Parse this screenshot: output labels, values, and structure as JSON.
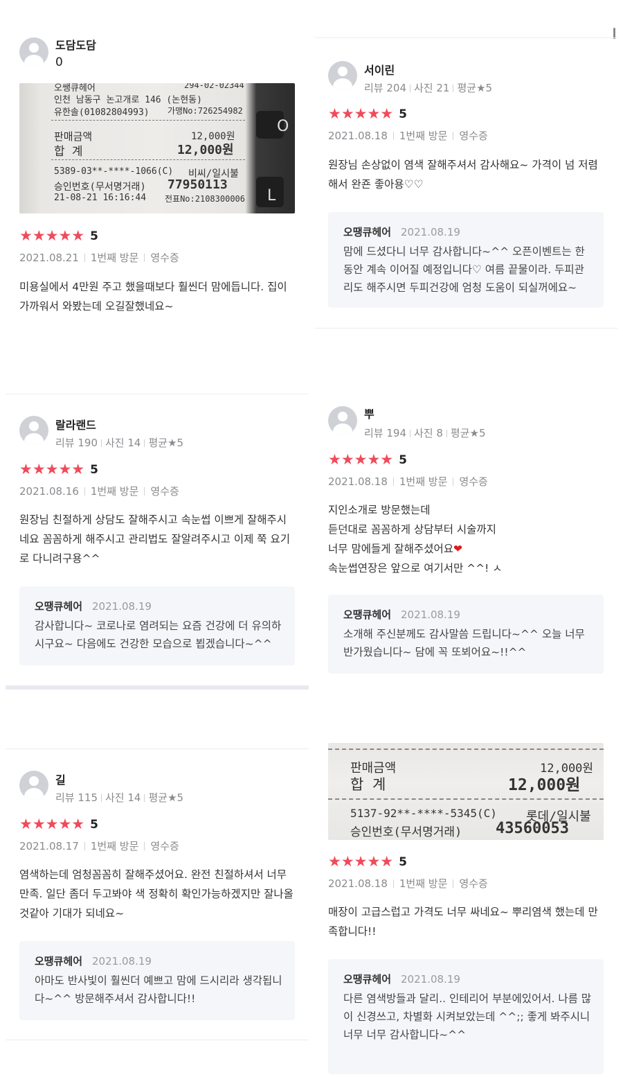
{
  "reviews": [
    {
      "nickname": "도담도담",
      "count_line": "0",
      "score": "5",
      "date": "2021.08.21",
      "visit": "1번째 방문",
      "proof": "영수증",
      "text": "미용실에서 4만원 주고 했을때보다 훨씬더 맘에듭니다. 집이 가까워서 와봤는데 오길잘했네요~",
      "receipt": {
        "line1": "오쌩큐헤어",
        "line1b": "294-02-02344",
        "line2": "인천 남동구 논고개로 146 (논현동)",
        "line3": "유한솔(01082804993)",
        "line3b": "가맹No:726254982",
        "sale_label": "판매금액",
        "sale_value": "12,000원",
        "total_label": "합  계",
        "total_value": "12,000원",
        "card": "5389-03**-****-1066(C)",
        "card_b": "비씨/일시불",
        "approval_label": "승인번호(무서명거래)",
        "approval_value": "77950113",
        "datetime": "21-08-21 16:16:44",
        "slip": "전표No:2108300006",
        "key1": "O",
        "key2": "L"
      }
    },
    {
      "nickname": "서이린",
      "stats": [
        "리뷰 204",
        "사진 21",
        "평균★5"
      ],
      "score": "5",
      "date": "2021.08.18",
      "visit": "1번째 방문",
      "proof": "영수증",
      "text": "원장님 손상없이 염색 잘해주셔서 감사해요~ 가격이 넘 저렴해서 완죤 좋아용♡♡",
      "reply": {
        "name": "오땡큐헤어",
        "date": "2021.08.19",
        "text": "맘에 드셨다니 너무 감사합니다~^^ 오픈이벤트는 한동안 계속 이어질 예정입니다♡ 여름 끝물이라. 두피관리도 해주시면 두피건강에 엄청 도움이 되실꺼에요~"
      }
    },
    {
      "nickname": "랄라랜드",
      "stats": [
        "리뷰 190",
        "사진 14",
        "평균★5"
      ],
      "score": "5",
      "date": "2021.08.16",
      "visit": "1번째 방문",
      "proof": "영수증",
      "text": "원장님 친절하게 상담도 잘해주시고 속눈썹 이쁘게 잘해주시네요 꼼꼼하게 해주시고 관리법도 잘알려주시고 이제 쭉 요기로 다니려구용^^",
      "reply": {
        "name": "오땡큐헤어",
        "date": "2021.08.19",
        "text": "감사합니다~ 코로나로 염려되는 요즘 건강에 더 유의하시구요~ 다음에도 건강한 모습으로 뵙겠습니다~^^"
      }
    },
    {
      "nickname": "뿌",
      "stats": [
        "리뷰 194",
        "사진 8",
        "평균★5"
      ],
      "score": "5",
      "date": "2021.08.18",
      "visit": "1번째 방문",
      "proof": "영수증",
      "lines": [
        "지인소개로 방문했는데",
        "듣던대로 꼼꼼하게 상담부터 시술까지",
        "너무 맘에들게 잘해주셨어요",
        "속눈썹연장은 앞으로 여기서만 ^^! ㅅ"
      ],
      "heart": "❤",
      "reply": {
        "name": "오땡큐헤어",
        "date": "2021.08.19",
        "text": "소개해 주신분께도 감사말씀 드립니다~^^ 오늘 너무 반가웠습니다~ 담에 꼭 또뵈어요~!!^^"
      }
    },
    {
      "nickname": "길",
      "stats": [
        "리뷰 115",
        "사진 14",
        "평균★5"
      ],
      "score": "5",
      "date": "2021.08.17",
      "visit": "1번째 방문",
      "proof": "영수증",
      "text": "염색하는데 엄청꼼꼼히 잘해주셨어요. 완전 친절하셔서 너무 만족. 일단 좀더 두고봐야 색 정확히 확인가능하겠지만 잘나올것같아 기대가 되네요~",
      "reply": {
        "name": "오땡큐헤어",
        "date": "2021.08.19",
        "text": "아마도 반사빛이 훨씬더 예쁘고 맘에 드시리라 생각됩니다~^^ 방문해주셔서 감사합니다!!"
      }
    },
    {
      "score": "5",
      "date": "2021.08.18",
      "visit": "1번째 방문",
      "proof": "영수증",
      "text": "매장이 고급스럽고 가격도 너무 싸네요~ 뿌리염색 했는데 만족합니다!!",
      "receipt": {
        "sale_label": "판매금액",
        "sale_value": "12,000원",
        "total_label": "합  계",
        "total_value": "12,000원",
        "card": "5137-92**-****-5345(C)",
        "card_b": "롯데/일시불",
        "approval_label": "승인번호(무서명거래)",
        "approval_value": "43560053"
      },
      "reply": {
        "name": "오땡큐헤어",
        "date": "2021.08.19",
        "text": "다른 염색방들과 달리.. 인테리어 부분에있어서. 나름 많이 신경쓰고, 차별화 시켜보았는데 ^^;; 좋게 봐주시니 너무 너무 감사합니다~^^"
      }
    }
  ],
  "stars": "★★★★★",
  "colors": {
    "star": "#ef4b5a",
    "reply_bg": "#f5f6f9",
    "muted": "#8a8a8f"
  }
}
